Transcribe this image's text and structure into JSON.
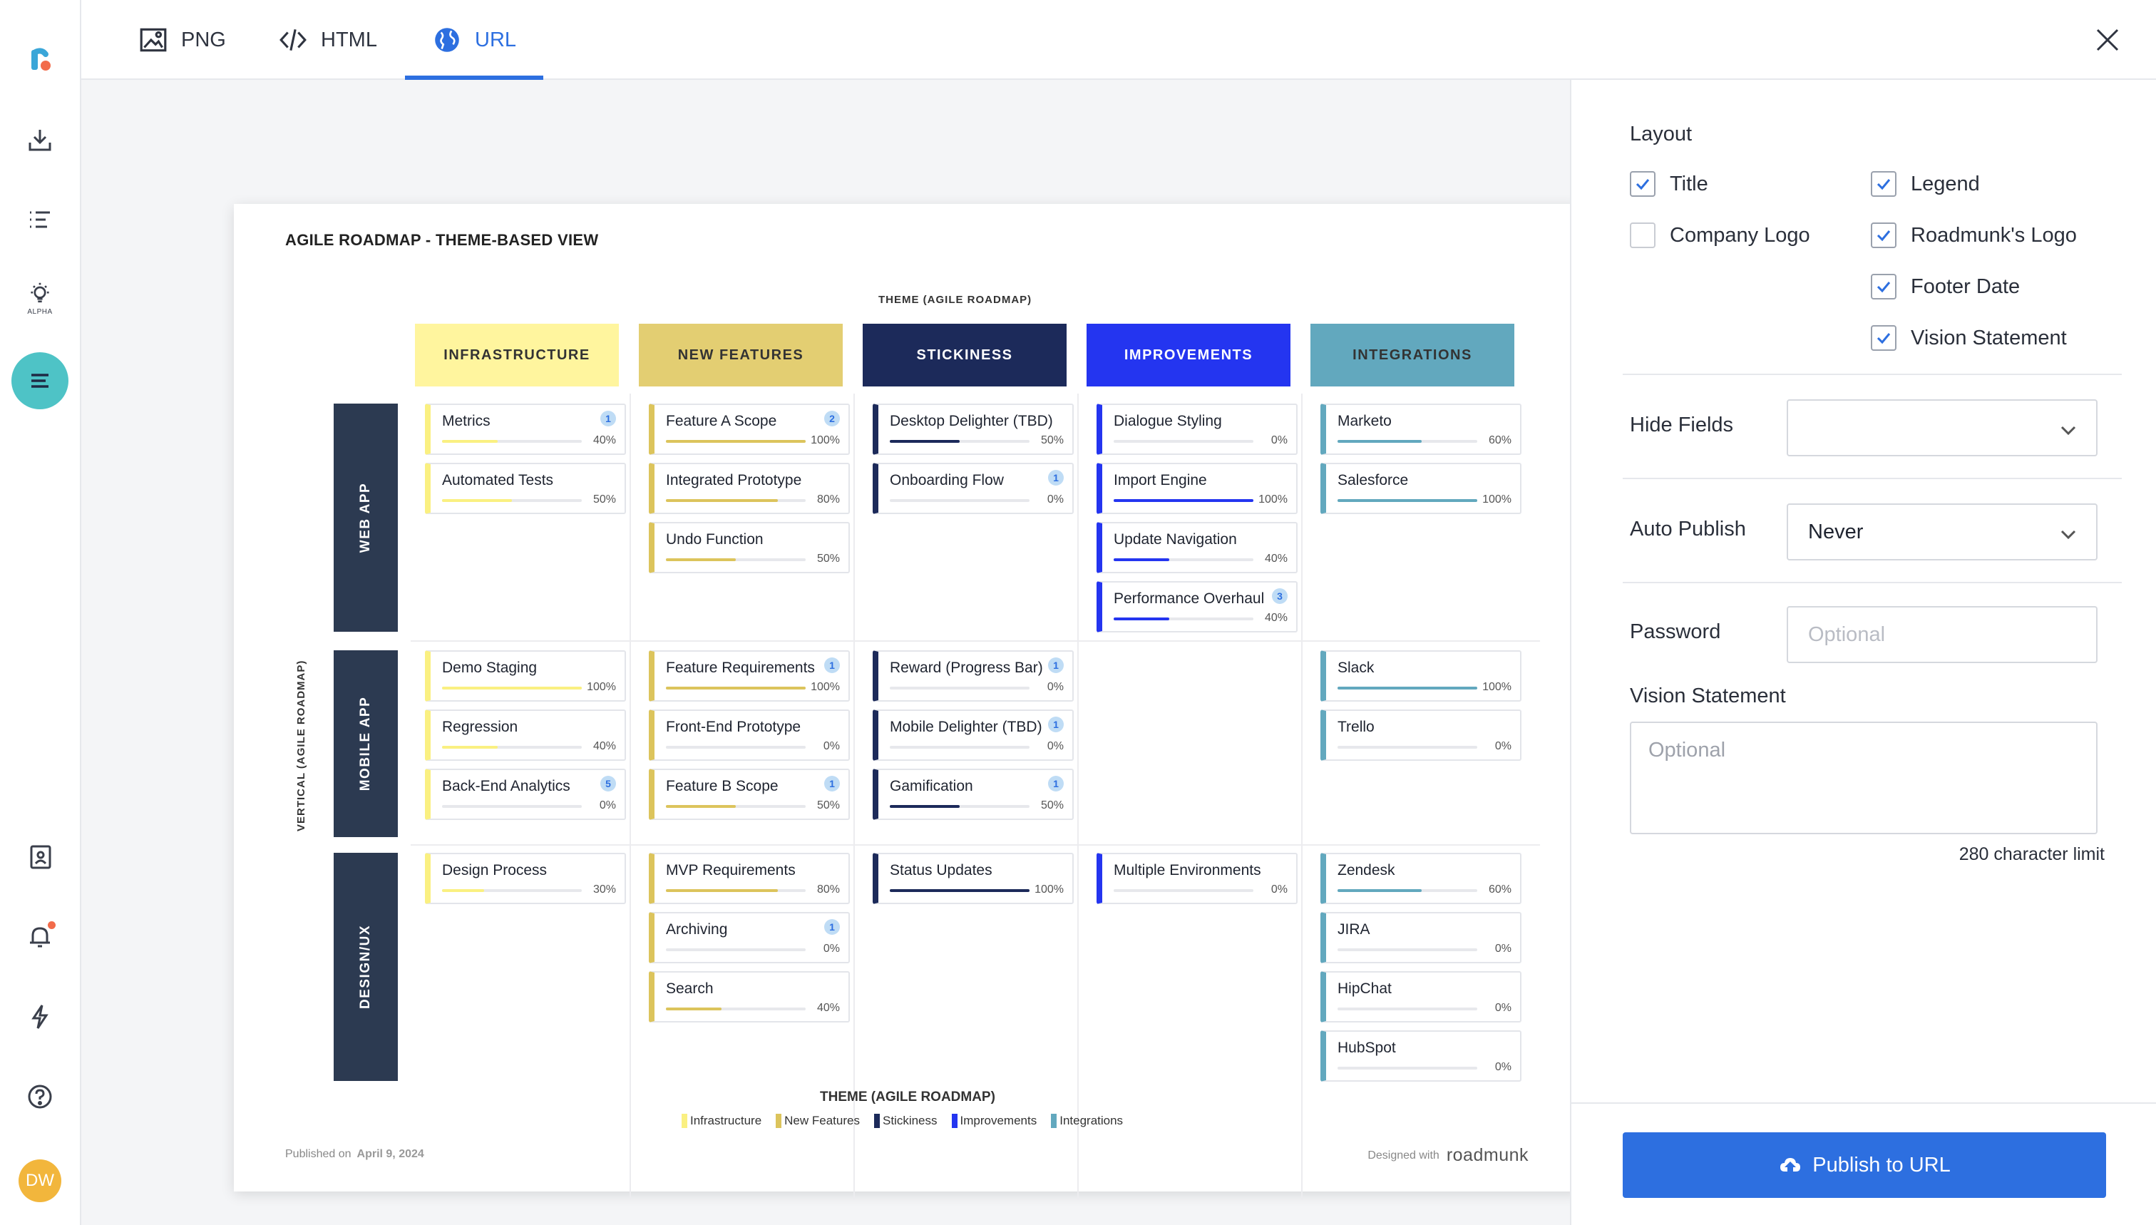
{
  "tabs": [
    {
      "label": "PNG",
      "icon": "image-icon"
    },
    {
      "label": "HTML",
      "icon": "code-icon"
    },
    {
      "label": "URL",
      "icon": "globe-icon",
      "active": true
    }
  ],
  "rail": {
    "alpha_label": "ALPHA",
    "avatar_initials": "DW",
    "icons": [
      "roadmunk-logo",
      "download-icon",
      "list-icon",
      "lightbulb-icon",
      "roadmap-icon",
      "contacts-icon",
      "bell-icon",
      "lightning-icon",
      "help-icon"
    ]
  },
  "roadmap": {
    "title": "AGILE ROADMAP - THEME-BASED VIEW",
    "theme_caption": "THEME (AGILE ROADMAP)",
    "vertical_caption": "VERTICAL (AGILE ROADMAP)",
    "themes": [
      {
        "label": "INFRASTRUCTURE",
        "bg": "#FFF59E",
        "fg": "#333333",
        "accent": "#FAF081"
      },
      {
        "label": "NEW FEATURES",
        "bg": "#E3CE72",
        "fg": "#333333",
        "accent": "#DCC45C"
      },
      {
        "label": "STICKINESS",
        "bg": "#1C2A5A",
        "fg": "#FFFFFF",
        "accent": "#1C2A5A"
      },
      {
        "label": "IMPROVEMENTS",
        "bg": "#2435F0",
        "fg": "#FFFFFF",
        "accent": "#2435F0"
      },
      {
        "label": "INTEGRATIONS",
        "bg": "#62A8BE",
        "fg": "#333333",
        "accent": "#62A8BE"
      }
    ],
    "rows": [
      "WEB APP",
      "MOBILE APP",
      "DESIGN/UX"
    ],
    "cards": [
      {
        "col": 0,
        "row": 0,
        "slot": 0,
        "name": "Metrics",
        "badge": "1",
        "pct": "40%",
        "progress": 0.4
      },
      {
        "col": 0,
        "row": 0,
        "slot": 1,
        "name": "Automated Tests",
        "badge": "",
        "pct": "50%",
        "progress": 0.5
      },
      {
        "col": 1,
        "row": 0,
        "slot": 0,
        "name": "Feature A Scope",
        "badge": "2",
        "pct": "100%",
        "progress": 1.0
      },
      {
        "col": 1,
        "row": 0,
        "slot": 1,
        "name": "Integrated Prototype",
        "badge": "",
        "pct": "80%",
        "progress": 0.8
      },
      {
        "col": 1,
        "row": 0,
        "slot": 2,
        "name": "Undo Function",
        "badge": "",
        "pct": "50%",
        "progress": 0.5
      },
      {
        "col": 2,
        "row": 0,
        "slot": 0,
        "name": "Desktop Delighter (TBD)",
        "badge": "",
        "pct": "50%",
        "progress": 0.5
      },
      {
        "col": 2,
        "row": 0,
        "slot": 1,
        "name": "Onboarding Flow",
        "badge": "1",
        "pct": "0%",
        "progress": 0
      },
      {
        "col": 3,
        "row": 0,
        "slot": 0,
        "name": "Dialogue Styling",
        "badge": "",
        "pct": "0%",
        "progress": 0
      },
      {
        "col": 3,
        "row": 0,
        "slot": 1,
        "name": "Import Engine",
        "badge": "",
        "pct": "100%",
        "progress": 1.0
      },
      {
        "col": 3,
        "row": 0,
        "slot": 2,
        "name": "Update Navigation",
        "badge": "",
        "pct": "40%",
        "progress": 0.4
      },
      {
        "col": 3,
        "row": 0,
        "slot": 3,
        "name": "Performance Overhaul",
        "badge": "3",
        "pct": "40%",
        "progress": 0.4
      },
      {
        "col": 4,
        "row": 0,
        "slot": 0,
        "name": "Marketo",
        "badge": "",
        "pct": "60%",
        "progress": 0.6
      },
      {
        "col": 4,
        "row": 0,
        "slot": 1,
        "name": "Salesforce",
        "badge": "",
        "pct": "100%",
        "progress": 1.0
      },
      {
        "col": 0,
        "row": 1,
        "slot": 0,
        "name": "Demo Staging",
        "badge": "",
        "pct": "100%",
        "progress": 1.0
      },
      {
        "col": 0,
        "row": 1,
        "slot": 1,
        "name": "Regression",
        "badge": "",
        "pct": "40%",
        "progress": 0.4
      },
      {
        "col": 0,
        "row": 1,
        "slot": 2,
        "name": "Back-End Analytics",
        "badge": "5",
        "pct": "0%",
        "progress": 0
      },
      {
        "col": 1,
        "row": 1,
        "slot": 0,
        "name": "Feature Requirements",
        "badge": "1",
        "pct": "100%",
        "progress": 1.0
      },
      {
        "col": 1,
        "row": 1,
        "slot": 1,
        "name": "Front-End Prototype",
        "badge": "",
        "pct": "0%",
        "progress": 0
      },
      {
        "col": 1,
        "row": 1,
        "slot": 2,
        "name": "Feature B Scope",
        "badge": "1",
        "pct": "50%",
        "progress": 0.5
      },
      {
        "col": 2,
        "row": 1,
        "slot": 0,
        "name": "Reward (Progress Bar)",
        "badge": "1",
        "pct": "0%",
        "progress": 0
      },
      {
        "col": 2,
        "row": 1,
        "slot": 1,
        "name": "Mobile Delighter (TBD)",
        "badge": "1",
        "pct": "0%",
        "progress": 0
      },
      {
        "col": 2,
        "row": 1,
        "slot": 2,
        "name": "Gamification",
        "badge": "1",
        "pct": "50%",
        "progress": 0.5
      },
      {
        "col": 4,
        "row": 1,
        "slot": 0,
        "name": "Slack",
        "badge": "",
        "pct": "100%",
        "progress": 1.0
      },
      {
        "col": 4,
        "row": 1,
        "slot": 1,
        "name": "Trello",
        "badge": "",
        "pct": "0%",
        "progress": 0
      },
      {
        "col": 0,
        "row": 2,
        "slot": 0,
        "name": "Design Process",
        "badge": "",
        "pct": "30%",
        "progress": 0.3
      },
      {
        "col": 1,
        "row": 2,
        "slot": 0,
        "name": "MVP Requirements",
        "badge": "",
        "pct": "80%",
        "progress": 0.8
      },
      {
        "col": 1,
        "row": 2,
        "slot": 1,
        "name": "Archiving",
        "badge": "1",
        "pct": "0%",
        "progress": 0
      },
      {
        "col": 1,
        "row": 2,
        "slot": 2,
        "name": "Search",
        "badge": "",
        "pct": "40%",
        "progress": 0.4
      },
      {
        "col": 2,
        "row": 2,
        "slot": 0,
        "name": "Status Updates",
        "badge": "",
        "pct": "100%",
        "progress": 1.0
      },
      {
        "col": 3,
        "row": 2,
        "slot": 0,
        "name": "Multiple Environments",
        "badge": "",
        "pct": "0%",
        "progress": 0
      },
      {
        "col": 4,
        "row": 2,
        "slot": 0,
        "name": "Zendesk",
        "badge": "",
        "pct": "60%",
        "progress": 0.6
      },
      {
        "col": 4,
        "row": 2,
        "slot": 1,
        "name": "JIRA",
        "badge": "",
        "pct": "0%",
        "progress": 0
      },
      {
        "col": 4,
        "row": 2,
        "slot": 2,
        "name": "HipChat",
        "badge": "",
        "pct": "0%",
        "progress": 0
      },
      {
        "col": 4,
        "row": 2,
        "slot": 3,
        "name": "HubSpot",
        "badge": "",
        "pct": "0%",
        "progress": 0
      }
    ],
    "legend_title": "THEME (AGILE ROADMAP)",
    "legend": [
      "Infrastructure",
      "New Features",
      "Stickiness",
      "Improvements",
      "Integrations"
    ],
    "published_label": "Published on",
    "published_date": "April 9, 2024",
    "designed_label": "Designed with",
    "brand": "roadmunk"
  },
  "panel": {
    "layout_label": "Layout",
    "checkboxes": [
      {
        "label": "Title",
        "checked": true
      },
      {
        "label": "Legend",
        "checked": true
      },
      {
        "label": "Company Logo",
        "checked": false
      },
      {
        "label": "Roadmunk's Logo",
        "checked": true
      },
      {
        "label": "Footer Date",
        "checked": true
      },
      {
        "label": "Vision Statement",
        "checked": true
      }
    ],
    "hide_fields_label": "Hide Fields",
    "hide_fields_value": "",
    "auto_publish_label": "Auto Publish",
    "auto_publish_value": "Never",
    "password_label": "Password",
    "password_placeholder": "Optional",
    "vision_label": "Vision Statement",
    "vision_placeholder": "Optional",
    "char_limit": "280 character limit",
    "publish_label": "Publish to URL"
  },
  "colors": {
    "accent": "#2D6FE0",
    "rail_active": "#4EC3C6",
    "row_label": "#2C3A51",
    "notification": "#F26B4A",
    "avatar": "#F2B63C"
  }
}
